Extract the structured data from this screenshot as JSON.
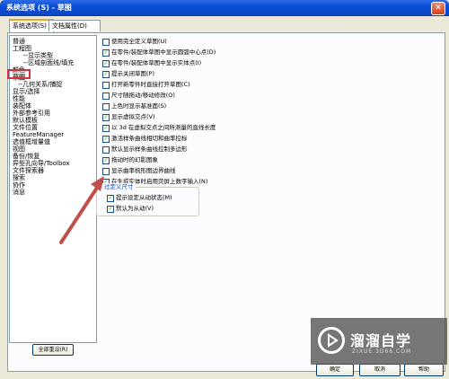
{
  "window": {
    "title": "系统选项 (S) - 草图",
    "close": "✕"
  },
  "tabs": [
    {
      "label": "系统选项(S)",
      "active": true
    },
    {
      "label": "文档属性(D)",
      "active": false
    }
  ],
  "tree": {
    "items": [
      {
        "label": "普通",
        "indent": 0
      },
      {
        "label": "工程图",
        "indent": 0
      },
      {
        "label": "显示类型",
        "indent": 2
      },
      {
        "label": "区域剖面线/填充",
        "indent": 2
      },
      {
        "label": "颜色",
        "indent": 0
      },
      {
        "label": "草图",
        "indent": 0,
        "selected": true
      },
      {
        "label": "几何关系/捕捉",
        "indent": 1
      },
      {
        "label": "显示/选择",
        "indent": 0
      },
      {
        "label": "性能",
        "indent": 0
      },
      {
        "label": "装配体",
        "indent": 0
      },
      {
        "label": "外部参考引用",
        "indent": 0
      },
      {
        "label": "默认模板",
        "indent": 0
      },
      {
        "label": "文件位置",
        "indent": 0
      },
      {
        "label": "FeatureManager",
        "indent": 0
      },
      {
        "label": "选值框增量值",
        "indent": 0
      },
      {
        "label": "视图",
        "indent": 0
      },
      {
        "label": "备份/恢复",
        "indent": 0
      },
      {
        "label": "异型孔向导/Toolbox",
        "indent": 0
      },
      {
        "label": "文件探索器",
        "indent": 0
      },
      {
        "label": "搜索",
        "indent": 0
      },
      {
        "label": "协作",
        "indent": 0
      },
      {
        "label": "消息",
        "indent": 0
      }
    ],
    "reset_label": "全部重设(R)"
  },
  "options": [
    {
      "label": "使用完全定义草图(U)",
      "checked": false
    },
    {
      "label": "在零件/装配体草图中显示圆弧中心点(D)",
      "checked": true
    },
    {
      "label": "在零件/装配体草图中显示实体点(I)",
      "checked": true
    },
    {
      "label": "提示关闭草图(P)",
      "checked": true
    },
    {
      "label": "打开新零件时直接打开草图(C)",
      "checked": false
    },
    {
      "label": "尺寸随拖动/移动修改(O)",
      "checked": false
    },
    {
      "label": "上色时显示基准面(S)",
      "checked": false
    },
    {
      "label": "显示虚拟交点(V)",
      "checked": true
    },
    {
      "label": "以 3d 在虚拟交点之间所测量的直线长度",
      "checked": true
    },
    {
      "label": "激活样条曲线相切和曲率控标",
      "checked": true
    },
    {
      "label": "默认显示样条曲线控制多边形",
      "checked": false
    },
    {
      "label": "拖动时的幻影图象",
      "checked": true
    },
    {
      "label": "显示曲率梳形图边界曲线",
      "checked": false
    },
    {
      "label": "在生成实体时启用荧屏上数字输入(N)",
      "checked": true
    }
  ],
  "group": {
    "title": "过定义尺寸",
    "options": [
      {
        "label": "提示设定从动状态(M)",
        "checked": true
      },
      {
        "label": "默认为从动(V)",
        "checked": true
      }
    ]
  },
  "buttons": {
    "ok": "确定",
    "cancel": "取消",
    "help": "帮助"
  },
  "watermark": {
    "main": "溜溜自学",
    "sub": "ZIXUE.3D66.COM"
  },
  "colors": {
    "titlebar": "#0a4ed6",
    "highlight": "#d2333a",
    "arrow": "#c0504d"
  }
}
